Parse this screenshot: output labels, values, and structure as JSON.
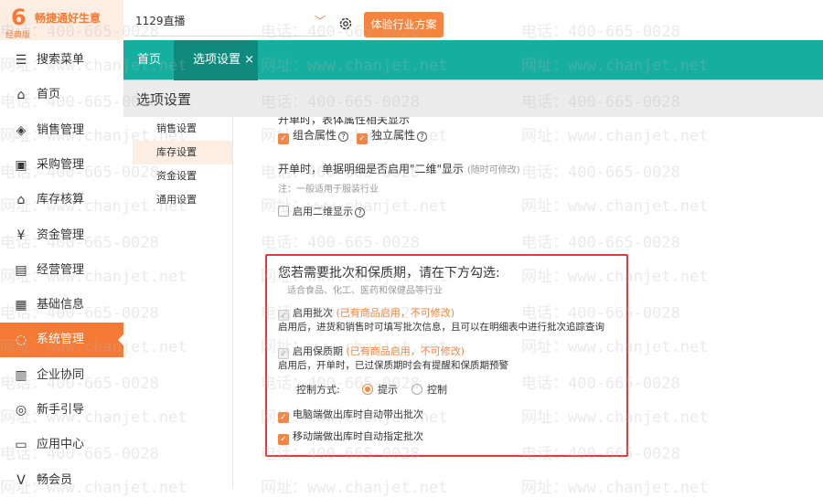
{
  "logo": {
    "name": "畅捷通好生意",
    "edition": "经典版"
  },
  "header": {
    "company": "1129直播",
    "try_button": "体验行业方案"
  },
  "tabs": [
    {
      "label": "首页"
    },
    {
      "label": "选项设置",
      "close": "×"
    }
  ],
  "page_title": "选项设置",
  "sidebar": {
    "items": [
      {
        "label": "搜索菜单",
        "icon": "search-menu-icon"
      },
      {
        "label": "首页",
        "icon": "home-icon"
      },
      {
        "label": "销售管理",
        "icon": "sales-icon"
      },
      {
        "label": "采购管理",
        "icon": "purchase-icon"
      },
      {
        "label": "库存核算",
        "icon": "inventory-icon"
      },
      {
        "label": "资金管理",
        "icon": "money-icon"
      },
      {
        "label": "经营管理",
        "icon": "report-icon"
      },
      {
        "label": "基础信息",
        "icon": "info-icon"
      },
      {
        "label": "系统管理",
        "icon": "system-icon",
        "active": true
      },
      {
        "label": "企业协同",
        "icon": "collab-icon"
      },
      {
        "label": "新手引导",
        "icon": "guide-icon"
      },
      {
        "label": "应用中心",
        "icon": "app-icon"
      },
      {
        "label": "畅会员",
        "icon": "vip-icon"
      }
    ]
  },
  "subnav": [
    {
      "label": "销售设置"
    },
    {
      "label": "库存设置",
      "active": true
    },
    {
      "label": "资金设置"
    },
    {
      "label": "通用设置"
    }
  ],
  "content": {
    "cut_heading": "开单时，表体属性相关显示",
    "attr_combo": "组合属性",
    "attr_indep": "独立属性",
    "matrix_title": "开单时，单据明细是否启用\"二维\"显示",
    "matrix_hint": "(随时可修改)",
    "matrix_note": "注：一般适用于服装行业",
    "matrix_enable": "启用二维显示",
    "batch_title": "您若需要批次和保质期，请在下方勾选:",
    "batch_sub": "适合食品、化工、医药和保健品等行业",
    "batch_enable": "启用批次",
    "batch_locked": "(已有商品启用，不可修改)",
    "batch_desc": "启用后，进货和销售时可填写批次信息，且可以在明细表中进行批次追踪查询",
    "shelf_enable": "启用保质期",
    "shelf_locked": "(已有商品启用，不可修改)",
    "shelf_desc": "启用后，开单时，已过保质期时会有提醒和保质期预警",
    "control_label": "控制方式:",
    "radio_prompt": "提示",
    "radio_control": "控制",
    "control_selected": "提示",
    "pc_auto": "电脑端做出库时自动带出批次",
    "mobile_auto": "移动端做出库时自动指定批次"
  },
  "watermark": {
    "phone": "电话：400-665-0028",
    "site": "网址：www.chanjet.net"
  }
}
